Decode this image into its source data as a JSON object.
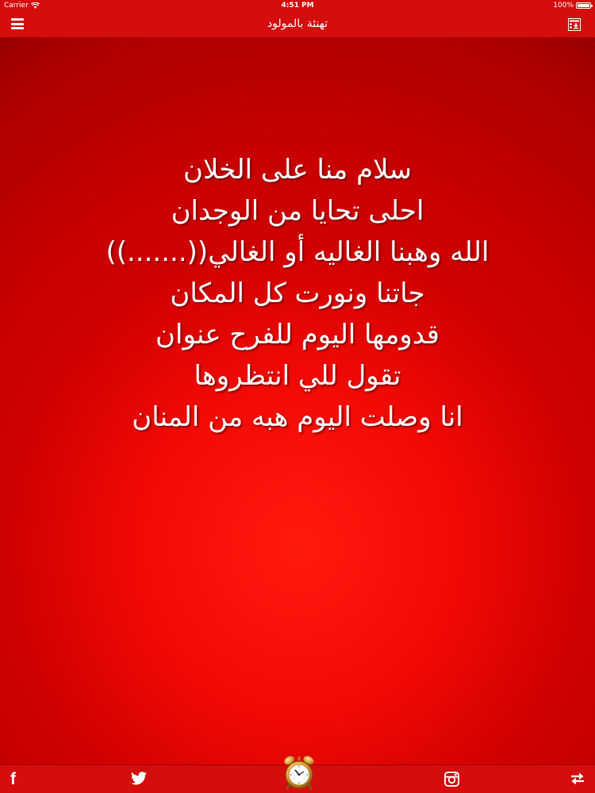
{
  "status_bar": {
    "carrier": "Carrier",
    "time": "4:51 PM",
    "battery": "100%",
    "battery_level": 1.0
  },
  "nav_bar": {
    "title": "تهنئة بالمولود",
    "left_icon": "menu-icon",
    "right_icon": "list-download-icon"
  },
  "poem": {
    "lines": [
      "سلام منا على الخلان",
      "احلى تحايا من الوجدان",
      "الله وهبنا الغاليه أو الغالي((.......))",
      "جاتنا ونورت كل المكان",
      "قدومها اليوم للفرح عنوان",
      "تقول للي انتظروها",
      "انا وصلت اليوم هبه من المنان"
    ]
  },
  "tab_bar": {
    "facebook_label": "f",
    "items": [
      "facebook-icon",
      "twitter-icon",
      "alarm-clock-icon",
      "instagram-icon",
      "share-arrows-icon"
    ]
  },
  "colors": {
    "bar_red": "#d40d0d",
    "background_red": "#e00000",
    "text": "#ffffff"
  }
}
